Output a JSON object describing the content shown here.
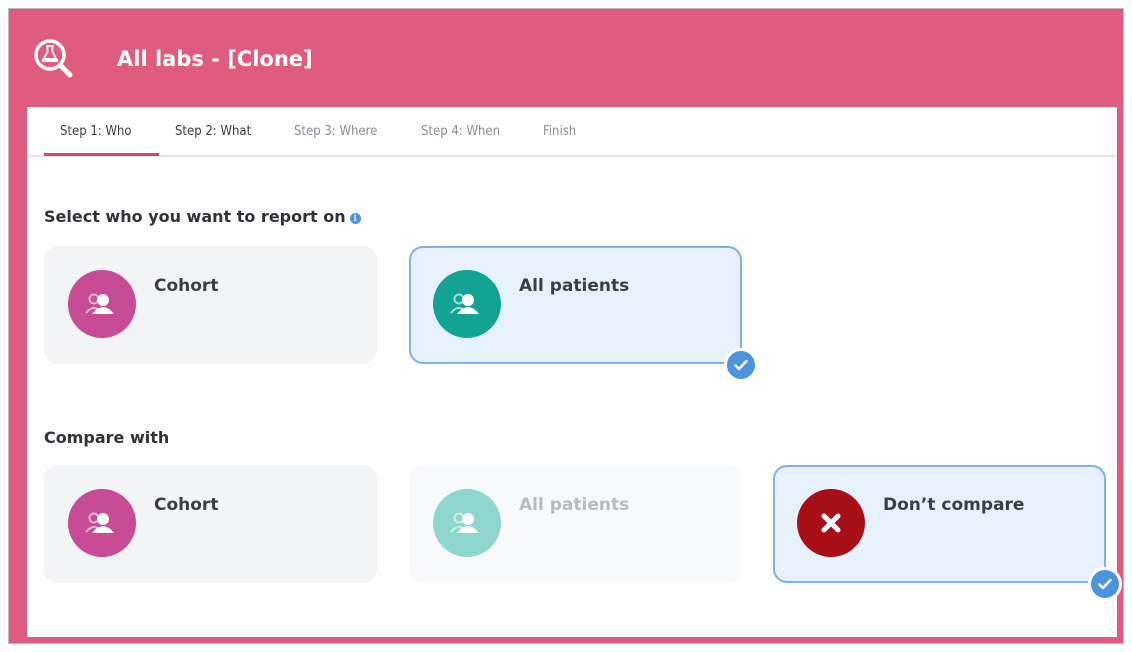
{
  "header": {
    "title": "All labs - [Clone]",
    "logo_icon": "lab-flask-search-icon"
  },
  "tabs": [
    {
      "label": "Step 1: Who",
      "state": "active"
    },
    {
      "label": "Step 2: What",
      "state": "done"
    },
    {
      "label": "Step 3: Where",
      "state": "pending"
    },
    {
      "label": "Step 4: When",
      "state": "pending"
    },
    {
      "label": "Finish",
      "state": "pending"
    }
  ],
  "report_on": {
    "title": "Select who you want to report on",
    "info_icon": "info-icon",
    "options": [
      {
        "label": "Cohort",
        "icon": "person-group-icon",
        "color": "#c74b95",
        "selected": false
      },
      {
        "label": "All patients",
        "icon": "person-group-icon",
        "color": "#12a394",
        "selected": true
      }
    ]
  },
  "compare_with": {
    "title": "Compare with",
    "options": [
      {
        "label": "Cohort",
        "icon": "person-group-icon",
        "color": "#c74b95",
        "selected": false
      },
      {
        "label": "All patients",
        "icon": "person-group-icon",
        "color": "#8fd6cf",
        "selected": false,
        "disabled": true
      },
      {
        "label": "Don’t compare",
        "icon": "close-x-icon",
        "color": "#a90f16",
        "selected": true
      }
    ]
  },
  "colors": {
    "brand": "#e05c7e",
    "tab_active_underline": "#d1477b",
    "selected_border": "#7fb1ea",
    "check": "#4c93e0"
  }
}
